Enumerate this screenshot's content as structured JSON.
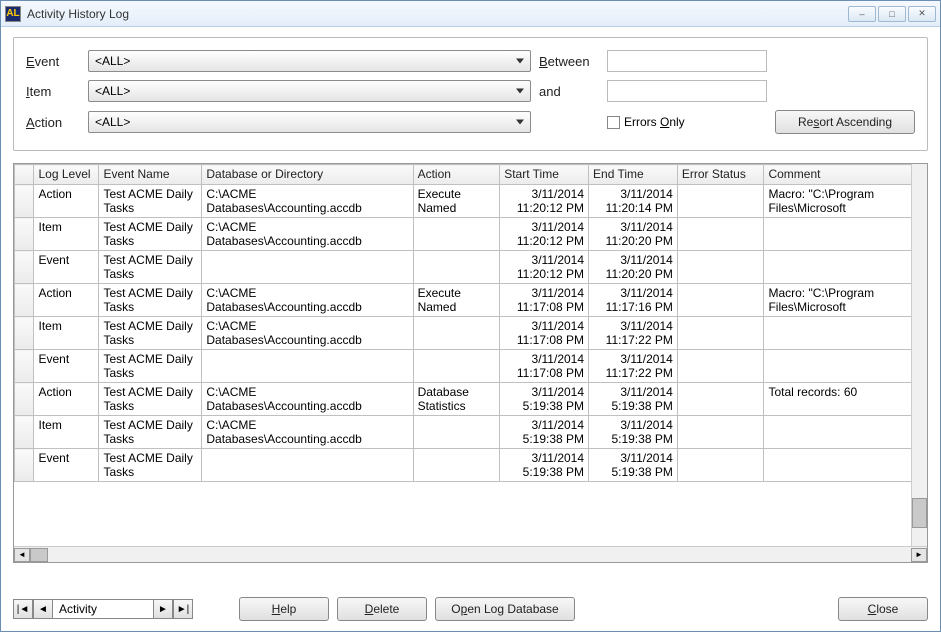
{
  "window": {
    "title": "Activity History Log"
  },
  "filter": {
    "event_label": "Event",
    "item_label": "Item",
    "action_label": "Action",
    "between_label": "Between",
    "and_label": "and",
    "errors_only_label": "Errors Only",
    "resort_button": "Resort Ascending",
    "event_value": "<ALL>",
    "item_value": "<ALL>",
    "action_value": "<ALL>",
    "between_value": "",
    "and_value": ""
  },
  "columns": {
    "log_level": "Log Level",
    "event_name": "Event Name",
    "db": "Database or Directory",
    "action": "Action",
    "start": "Start Time",
    "end": "End Time",
    "error": "Error Status",
    "comment": "Comment"
  },
  "rows": [
    {
      "level": "Action",
      "event": "Test ACME Daily Tasks",
      "db": "C:\\ACME Databases\\Accounting.accdb",
      "action": "Execute Named",
      "start": "3/11/2014 11:20:12 PM",
      "end": "3/11/2014 11:20:14 PM",
      "error": "",
      "comment": "Macro: \"C:\\Program Files\\Microsoft"
    },
    {
      "level": "Item",
      "event": "Test ACME Daily Tasks",
      "db": "C:\\ACME Databases\\Accounting.accdb",
      "action": "",
      "start": "3/11/2014 11:20:12 PM",
      "end": "3/11/2014 11:20:20 PM",
      "error": "",
      "comment": ""
    },
    {
      "level": "Event",
      "event": "Test ACME Daily Tasks",
      "db": "",
      "action": "",
      "start": "3/11/2014 11:20:12 PM",
      "end": "3/11/2014 11:20:20 PM",
      "error": "",
      "comment": ""
    },
    {
      "level": "Action",
      "event": "Test ACME Daily Tasks",
      "db": "C:\\ACME Databases\\Accounting.accdb",
      "action": "Execute Named",
      "start": "3/11/2014 11:17:08 PM",
      "end": "3/11/2014 11:17:16 PM",
      "error": "",
      "comment": "Macro: \"C:\\Program Files\\Microsoft"
    },
    {
      "level": "Item",
      "event": "Test ACME Daily Tasks",
      "db": "C:\\ACME Databases\\Accounting.accdb",
      "action": "",
      "start": "3/11/2014 11:17:08 PM",
      "end": "3/11/2014 11:17:22 PM",
      "error": "",
      "comment": ""
    },
    {
      "level": "Event",
      "event": "Test ACME Daily Tasks",
      "db": "",
      "action": "",
      "start": "3/11/2014 11:17:08 PM",
      "end": "3/11/2014 11:17:22 PM",
      "error": "",
      "comment": ""
    },
    {
      "level": "Action",
      "event": "Test ACME Daily Tasks",
      "db": "C:\\ACME Databases\\Accounting.accdb",
      "action": "Database Statistics",
      "start": "3/11/2014 5:19:38 PM",
      "end": "3/11/2014 5:19:38 PM",
      "error": "",
      "comment": "Total records: 60"
    },
    {
      "level": "Item",
      "event": "Test ACME Daily Tasks",
      "db": "C:\\ACME Databases\\Accounting.accdb",
      "action": "",
      "start": "3/11/2014 5:19:38 PM",
      "end": "3/11/2014 5:19:38 PM",
      "error": "",
      "comment": ""
    },
    {
      "level": "Event",
      "event": "Test ACME Daily Tasks",
      "db": "",
      "action": "",
      "start": "3/11/2014 5:19:38 PM",
      "end": "3/11/2014 5:19:38 PM",
      "error": "",
      "comment": ""
    }
  ],
  "nav": {
    "record_label": "Activity"
  },
  "buttons": {
    "help": "Help",
    "delete": "Delete",
    "open_log": "Open Log Database",
    "close": "Close"
  }
}
